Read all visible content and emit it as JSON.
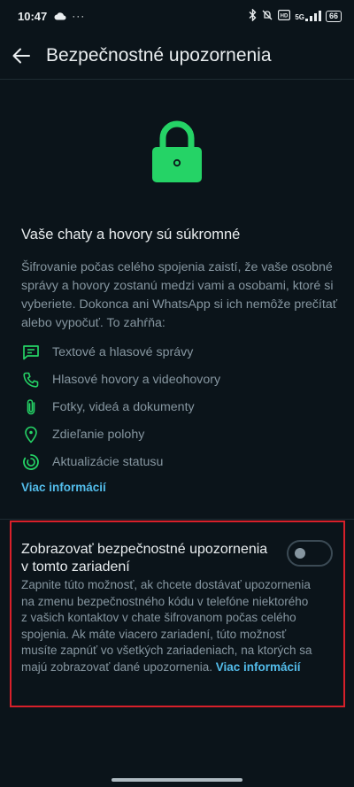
{
  "status_bar": {
    "time": "10:47",
    "battery": "66",
    "network": "5G",
    "extra_dots": "···",
    "icons": [
      "cloud-icon",
      "bluetooth-icon",
      "mute-icon",
      "volte-icon",
      "signal-icon",
      "battery-icon"
    ]
  },
  "app_bar": {
    "title": "Bezpečnostné upozornenia"
  },
  "info": {
    "title": "Vaše chaty a hovory sú súkromné",
    "description": "Šifrovanie počas celého spojenia zaistí, že vaše osobné správy a hovory zostanú medzi vami a osobami, ktoré si vyberiete. Dokonca ani WhatsApp si ich nemôže prečítať alebo vypočuť. To zahŕňa:",
    "features": [
      {
        "label": "Textové a hlasové správy",
        "icon": "message-icon"
      },
      {
        "label": "Hlasové hovory a videohovory",
        "icon": "phone-icon"
      },
      {
        "label": "Fotky, videá a dokumenty",
        "icon": "attachment-icon"
      },
      {
        "label": "Zdieľanie polohy",
        "icon": "location-icon"
      },
      {
        "label": "Aktualizácie statusu",
        "icon": "status-icon"
      }
    ],
    "more_link": "Viac informácií"
  },
  "setting": {
    "title": "Zobrazovať bezpečnostné upozornenia v tomto zariadení",
    "toggle_on": false,
    "description": "Zapnite túto možnosť, ak chcete dostávať upozornenia na zmenu bezpečnostného kódu v telefóne niektorého z vašich kontaktov v chate šifrovanom počas celého spojenia. Ak máte viacero zariadení, túto možnosť musíte zapnúť vo všetkých zariadeniach, na ktorých sa majú zobrazovať dané upozornenia.",
    "link": "Viac informácií"
  },
  "colors": {
    "background": "#0b141a",
    "accent_green": "#25d366",
    "link_blue": "#53bdeb",
    "highlight_red": "#d8202a"
  }
}
